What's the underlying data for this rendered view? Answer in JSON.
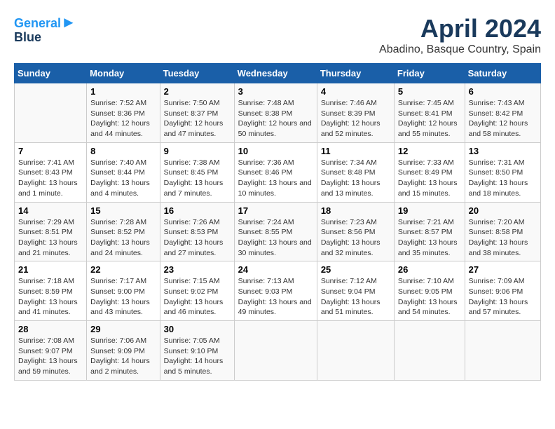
{
  "header": {
    "logo_line1": "General",
    "logo_line2": "Blue",
    "month_title": "April 2024",
    "location": "Abadino, Basque Country, Spain"
  },
  "weekdays": [
    "Sunday",
    "Monday",
    "Tuesday",
    "Wednesday",
    "Thursday",
    "Friday",
    "Saturday"
  ],
  "weeks": [
    [
      {
        "day": "",
        "sunrise": "",
        "sunset": "",
        "daylight": ""
      },
      {
        "day": "1",
        "sunrise": "Sunrise: 7:52 AM",
        "sunset": "Sunset: 8:36 PM",
        "daylight": "Daylight: 12 hours and 44 minutes."
      },
      {
        "day": "2",
        "sunrise": "Sunrise: 7:50 AM",
        "sunset": "Sunset: 8:37 PM",
        "daylight": "Daylight: 12 hours and 47 minutes."
      },
      {
        "day": "3",
        "sunrise": "Sunrise: 7:48 AM",
        "sunset": "Sunset: 8:38 PM",
        "daylight": "Daylight: 12 hours and 50 minutes."
      },
      {
        "day": "4",
        "sunrise": "Sunrise: 7:46 AM",
        "sunset": "Sunset: 8:39 PM",
        "daylight": "Daylight: 12 hours and 52 minutes."
      },
      {
        "day": "5",
        "sunrise": "Sunrise: 7:45 AM",
        "sunset": "Sunset: 8:41 PM",
        "daylight": "Daylight: 12 hours and 55 minutes."
      },
      {
        "day": "6",
        "sunrise": "Sunrise: 7:43 AM",
        "sunset": "Sunset: 8:42 PM",
        "daylight": "Daylight: 12 hours and 58 minutes."
      }
    ],
    [
      {
        "day": "7",
        "sunrise": "Sunrise: 7:41 AM",
        "sunset": "Sunset: 8:43 PM",
        "daylight": "Daylight: 13 hours and 1 minute."
      },
      {
        "day": "8",
        "sunrise": "Sunrise: 7:40 AM",
        "sunset": "Sunset: 8:44 PM",
        "daylight": "Daylight: 13 hours and 4 minutes."
      },
      {
        "day": "9",
        "sunrise": "Sunrise: 7:38 AM",
        "sunset": "Sunset: 8:45 PM",
        "daylight": "Daylight: 13 hours and 7 minutes."
      },
      {
        "day": "10",
        "sunrise": "Sunrise: 7:36 AM",
        "sunset": "Sunset: 8:46 PM",
        "daylight": "Daylight: 13 hours and 10 minutes."
      },
      {
        "day": "11",
        "sunrise": "Sunrise: 7:34 AM",
        "sunset": "Sunset: 8:48 PM",
        "daylight": "Daylight: 13 hours and 13 minutes."
      },
      {
        "day": "12",
        "sunrise": "Sunrise: 7:33 AM",
        "sunset": "Sunset: 8:49 PM",
        "daylight": "Daylight: 13 hours and 15 minutes."
      },
      {
        "day": "13",
        "sunrise": "Sunrise: 7:31 AM",
        "sunset": "Sunset: 8:50 PM",
        "daylight": "Daylight: 13 hours and 18 minutes."
      }
    ],
    [
      {
        "day": "14",
        "sunrise": "Sunrise: 7:29 AM",
        "sunset": "Sunset: 8:51 PM",
        "daylight": "Daylight: 13 hours and 21 minutes."
      },
      {
        "day": "15",
        "sunrise": "Sunrise: 7:28 AM",
        "sunset": "Sunset: 8:52 PM",
        "daylight": "Daylight: 13 hours and 24 minutes."
      },
      {
        "day": "16",
        "sunrise": "Sunrise: 7:26 AM",
        "sunset": "Sunset: 8:53 PM",
        "daylight": "Daylight: 13 hours and 27 minutes."
      },
      {
        "day": "17",
        "sunrise": "Sunrise: 7:24 AM",
        "sunset": "Sunset: 8:55 PM",
        "daylight": "Daylight: 13 hours and 30 minutes."
      },
      {
        "day": "18",
        "sunrise": "Sunrise: 7:23 AM",
        "sunset": "Sunset: 8:56 PM",
        "daylight": "Daylight: 13 hours and 32 minutes."
      },
      {
        "day": "19",
        "sunrise": "Sunrise: 7:21 AM",
        "sunset": "Sunset: 8:57 PM",
        "daylight": "Daylight: 13 hours and 35 minutes."
      },
      {
        "day": "20",
        "sunrise": "Sunrise: 7:20 AM",
        "sunset": "Sunset: 8:58 PM",
        "daylight": "Daylight: 13 hours and 38 minutes."
      }
    ],
    [
      {
        "day": "21",
        "sunrise": "Sunrise: 7:18 AM",
        "sunset": "Sunset: 8:59 PM",
        "daylight": "Daylight: 13 hours and 41 minutes."
      },
      {
        "day": "22",
        "sunrise": "Sunrise: 7:17 AM",
        "sunset": "Sunset: 9:00 PM",
        "daylight": "Daylight: 13 hours and 43 minutes."
      },
      {
        "day": "23",
        "sunrise": "Sunrise: 7:15 AM",
        "sunset": "Sunset: 9:02 PM",
        "daylight": "Daylight: 13 hours and 46 minutes."
      },
      {
        "day": "24",
        "sunrise": "Sunrise: 7:13 AM",
        "sunset": "Sunset: 9:03 PM",
        "daylight": "Daylight: 13 hours and 49 minutes."
      },
      {
        "day": "25",
        "sunrise": "Sunrise: 7:12 AM",
        "sunset": "Sunset: 9:04 PM",
        "daylight": "Daylight: 13 hours and 51 minutes."
      },
      {
        "day": "26",
        "sunrise": "Sunrise: 7:10 AM",
        "sunset": "Sunset: 9:05 PM",
        "daylight": "Daylight: 13 hours and 54 minutes."
      },
      {
        "day": "27",
        "sunrise": "Sunrise: 7:09 AM",
        "sunset": "Sunset: 9:06 PM",
        "daylight": "Daylight: 13 hours and 57 minutes."
      }
    ],
    [
      {
        "day": "28",
        "sunrise": "Sunrise: 7:08 AM",
        "sunset": "Sunset: 9:07 PM",
        "daylight": "Daylight: 13 hours and 59 minutes."
      },
      {
        "day": "29",
        "sunrise": "Sunrise: 7:06 AM",
        "sunset": "Sunset: 9:09 PM",
        "daylight": "Daylight: 14 hours and 2 minutes."
      },
      {
        "day": "30",
        "sunrise": "Sunrise: 7:05 AM",
        "sunset": "Sunset: 9:10 PM",
        "daylight": "Daylight: 14 hours and 5 minutes."
      },
      {
        "day": "",
        "sunrise": "",
        "sunset": "",
        "daylight": ""
      },
      {
        "day": "",
        "sunrise": "",
        "sunset": "",
        "daylight": ""
      },
      {
        "day": "",
        "sunrise": "",
        "sunset": "",
        "daylight": ""
      },
      {
        "day": "",
        "sunrise": "",
        "sunset": "",
        "daylight": ""
      }
    ]
  ]
}
